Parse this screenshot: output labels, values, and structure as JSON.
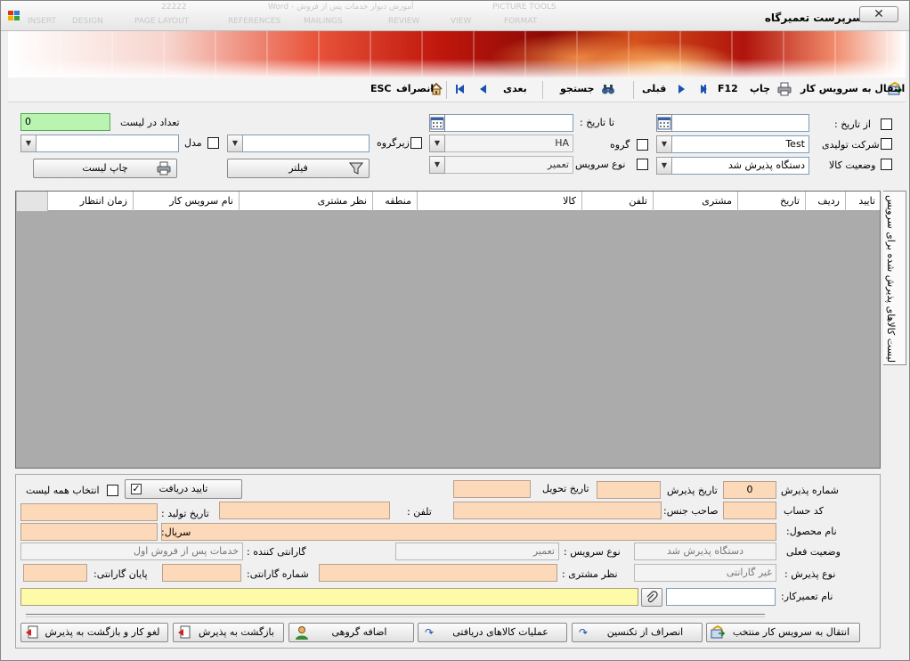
{
  "window": {
    "title": "سرپرست تعمیرگاه",
    "close_label": "✕",
    "ghost_tabs": [
      "INSERT",
      "DESIGN",
      "PAGE LAYOUT",
      "REFERENCES",
      "MAILINGS",
      "REVIEW",
      "VIEW",
      "FORMAT"
    ],
    "ghost_doc_title": "آموزش دیوار خدمات پس از فروش - Word",
    "ghost_tools": "PICTURE TOOLS",
    "ghost_number": "22222"
  },
  "toolbar": {
    "transfer_label": "انتقال به سرویس کار",
    "print_label": "چاپ",
    "print_shortcut": "F12",
    "prev_label": "قبلی",
    "search_label": "جستجو",
    "next_label": "بعدی",
    "cancel_label": "انصراف",
    "cancel_shortcut": "ESC"
  },
  "filters": {
    "from_date_label": "از تاریخ :",
    "to_date_label": "تا تاریخ :",
    "manufacturer_label": "شرکت تولیدی",
    "manufacturer_value": "Test",
    "group_label": "گروه",
    "group_value": "HA",
    "subgroup_label": "زیرگروه",
    "model_label": "مدل",
    "status_label": "وضعیت کالا",
    "status_value": "دستگاه پذیرش شد",
    "service_type_label": "نوع سرویس",
    "service_type_value": "تعمیر",
    "count_label": "تعداد در لیست",
    "count_value": "0",
    "print_list_label": "چاپ لیست",
    "filter_label": "فیلتر"
  },
  "grid": {
    "side_tab_label": "لیست کالاهای پذیرش شده برای سرویس",
    "columns": [
      "تایید",
      "ردیف",
      "تاریخ",
      "مشتری",
      "تلفن",
      "کالا",
      "منطقه",
      "نظر مشتری",
      "نام سرویس کار",
      "زمان انتظار"
    ]
  },
  "details": {
    "reception_no_label": "شماره پذیرش",
    "reception_no_value": "0",
    "reception_date_label": "تاریخ پذیرش",
    "delivery_date_label": "تاریخ تحویل",
    "confirm_receive_label": "تایید دریافت",
    "select_all_label": "انتخاب همه لیست",
    "account_code_label": "کد حساب",
    "owner_type_label": "صاحب جنس:",
    "phone_label": "تلفن :",
    "production_date_label": "تاریخ تولید :",
    "product_name_label": "نام محصول:",
    "serial_label": "سریال:",
    "current_status_label": "وضعیت فعلی",
    "current_status_value": "دستگاه پذیرش شد",
    "service_type_label": "نوع سرویس :",
    "service_type_value": "تعمیر",
    "guarantor_label": "گارانتی کننده :",
    "guarantor_value": "خدمات پس از فروش اول",
    "reception_type_label": "نوع پذیرش :",
    "reception_type_value": "غیر گارانتی",
    "customer_opinion_label": "نظر مشتری :",
    "guarantee_no_label": "شماره گارانتی:",
    "guarantee_end_label": "پایان گارانتی:",
    "repairman_label": "نام تعمیرکار:"
  },
  "actions": {
    "transfer_selected_label": "انتقال به سرویس کار  منتخب",
    "cancel_technician_label": "انصراف از تکنسین",
    "received_ops_label": "عملیات کالاهای دریافتی",
    "group_add_label": "اضافه گروهی",
    "back_to_reception_label": "بازگشت به پذیرش",
    "cancel_and_back_label": "لغو کار و بازگشت به پذیرش"
  }
}
